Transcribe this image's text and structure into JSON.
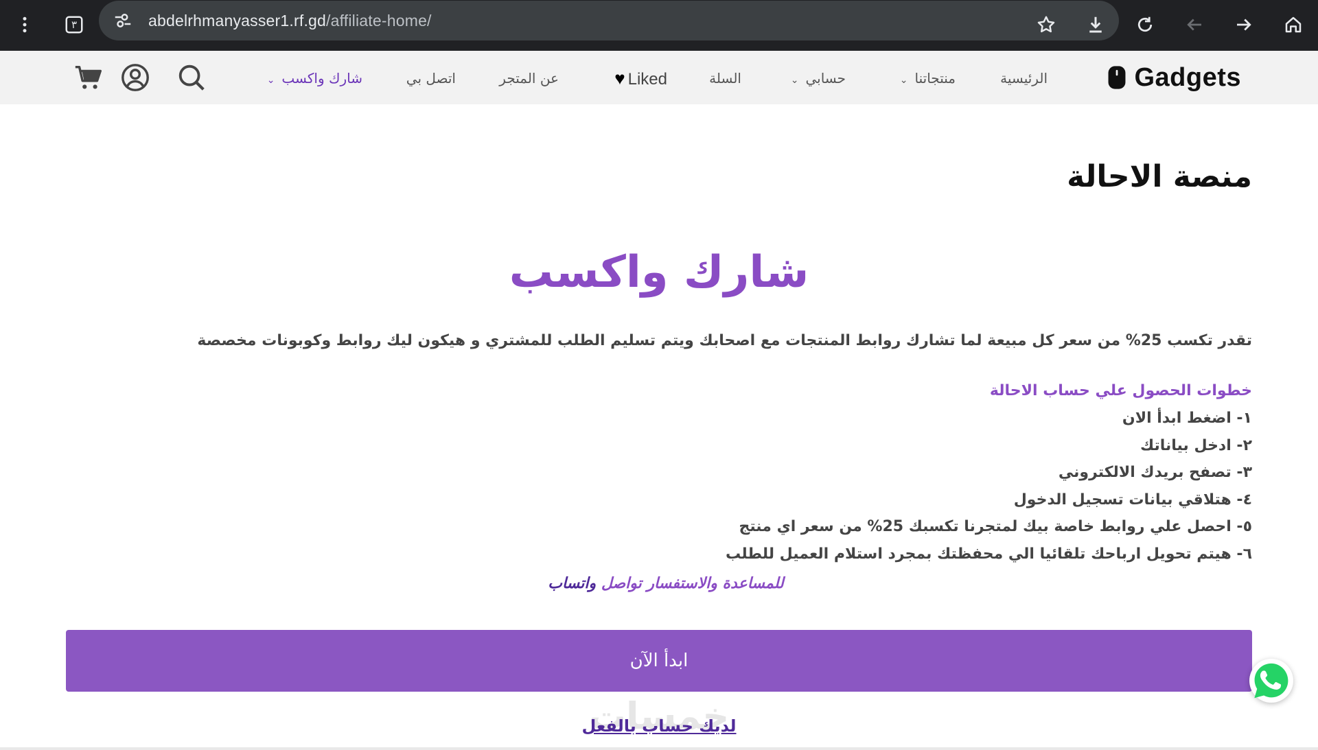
{
  "browser": {
    "url_domain": "abdelrhmanyasser1.rf.gd",
    "url_path": "/affiliate-home/",
    "tab_count": "٣",
    "icons": [
      "more-vert-icon",
      "tab-switcher-icon",
      "site-settings-icon",
      "bookmark-star-icon",
      "download-icon",
      "reload-icon",
      "back-arrow-icon",
      "forward-arrow-icon",
      "home-icon"
    ]
  },
  "header": {
    "logo_text": "Gadgets",
    "nav": {
      "home": "الرئيسية",
      "products": "منتجاتنا",
      "account": "حسابي",
      "cart": "السلة",
      "liked": "Liked",
      "about": "عن المتجر",
      "contact": "اتصل بي",
      "share": "شارك واكسب"
    },
    "icons": [
      "search-icon",
      "account-circle-icon",
      "cart-icon"
    ]
  },
  "main": {
    "page_title": "منصة الاحالة",
    "hero_title": "شارك واكسب",
    "lead": "تقدر تكسب 25% من سعر كل مبيعة لما تشارك روابط المنتجات مع اصحابك ويتم تسليم الطلب للمشتري و هيكون ليك روابط وكوبونات مخصصة",
    "steps_heading": "خطوات الحصول علي حساب الاحالة",
    "steps": [
      "١- اضغط ابدأ الان",
      "٢- ادخل بياناتك",
      "٣- تصفح بريدك الالكتروني",
      "٤- هتلاقي بيانات تسجيل الدخول",
      "٥- احصل علي روابط خاصة بيك لمتجرنا تكسبك 25% من سعر اي منتج",
      "٦- هيتم تحويل ارباحك تلقائيا الي محفظتك بمجرد استلام العميل للطلب"
    ],
    "help_text_part1": "للمساعدة والاستفسار تواصل",
    "help_text_part2": "واتساب",
    "cta_label": "ابدأ الآن",
    "have_account": "لديك حساب بالفعل",
    "watermark": "خمسات"
  },
  "colors": {
    "accent": "#8b57c2",
    "accent_dark": "#4f2a99",
    "chrome_bg": "#202124",
    "header_bg": "#f2f2f2",
    "whatsapp": "#25d366"
  }
}
